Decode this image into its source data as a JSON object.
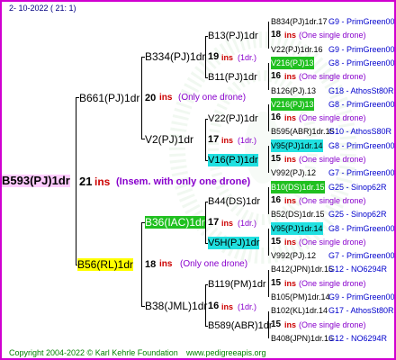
{
  "header": {
    "date": "2- 10-2022 ( 21: 1)"
  },
  "root": {
    "name": "B593(PJ)1dr",
    "num": "21",
    "ins": "ins",
    "note": "(Insem. with only one drone)"
  },
  "gen1": [
    {
      "name": "B661(PJ)1dr",
      "num": "20",
      "ins": "ins",
      "note": "(Only one drone)"
    },
    {
      "name": "B56(RL)1dr",
      "num": "18",
      "ins": "ins",
      "note": "(Only one drone)"
    }
  ],
  "gen2": [
    {
      "name": "B334(PJ)1dr"
    },
    {
      "name": "V2(PJ)1dr"
    },
    {
      "name": "B36(IAC)1dr"
    },
    {
      "name": "B38(JML)1dr"
    }
  ],
  "gen3": [
    {
      "name": "B13(PJ)1dr",
      "num": "19",
      "ins": "ins",
      "note": "(1dr.)"
    },
    {
      "name": "B11(PJ)1dr"
    },
    {
      "name": "V22(PJ)1dr",
      "num": "17",
      "ins": "ins",
      "note": "(1dr.)"
    },
    {
      "name": "V16(PJ)1dr"
    },
    {
      "name": "B44(DS)1dr",
      "num": "17",
      "ins": "ins",
      "note": "(1dr.)"
    },
    {
      "name": "V5H(PJ)1dr"
    },
    {
      "name": "B119(PM)1dr",
      "num": "16",
      "ins": "ins",
      "note": "(1dr.)"
    },
    {
      "name": "B589(ABR)1dr"
    }
  ],
  "gen4": [
    {
      "left": "B834(PJ)1dr.17",
      "right": "G9 - PrimGreen00"
    },
    {
      "num": "18",
      "ins": "ins",
      "note": "(One single drone)"
    },
    {
      "left": "V22(PJ)1dr.16",
      "right": "G9 - PrimGreen00"
    },
    {
      "left": "V216(PJ)13",
      "right": "G8 - PrimGreen00"
    },
    {
      "num": "16",
      "ins": "ins",
      "note": "(One single drone)"
    },
    {
      "left": "B126(PJ).13",
      "right": "G18 - AthosSt80R"
    },
    {
      "left": "V216(PJ)13",
      "right": "G8 - PrimGreen00"
    },
    {
      "num": "16",
      "ins": "ins",
      "note": "(One single drone)"
    },
    {
      "left": "B595(ABR)1dr.15",
      "right": "G10 - AthosS80R"
    },
    {
      "left": "V95(PJ)1dr.14",
      "right": "G8 - PrimGreen00"
    },
    {
      "num": "15",
      "ins": "ins",
      "note": "(One single drone)"
    },
    {
      "left": "V992(PJ).12",
      "right": "G7 - PrimGreen00"
    },
    {
      "left": "B10(DS)1dr.15",
      "right": "G25 - Sinop62R"
    },
    {
      "num": "16",
      "ins": "ins",
      "note": "(One single drone)"
    },
    {
      "left": "B52(DS)1dr.15",
      "right": "G25 - Sinop62R"
    },
    {
      "left": "V95(PJ)1dr.14",
      "right": "G8 - PrimGreen00"
    },
    {
      "num": "15",
      "ins": "ins",
      "note": "(One single drone)"
    },
    {
      "left": "V992(PJ).12",
      "right": "G7 - PrimGreen00"
    },
    {
      "left": "B412(JPN)1dr.15",
      "right": "G12 - NO6294R"
    },
    {
      "num": "15",
      "ins": "ins",
      "note": "(One single drone)"
    },
    {
      "left": "B105(PM)1dr.14",
      "right": "G9 - PrimGreen00"
    },
    {
      "left": "B102(KL)1dr.14",
      "right": "G17 - AthosSt80R"
    },
    {
      "num": "15",
      "ins": "ins",
      "note": "(One single drone)"
    },
    {
      "left": "B408(JPN)1dr.16",
      "right": "G12 - NO6294R"
    }
  ],
  "footer": {
    "copyright": "Copyright 2004-2022 © Karl Kehrle Foundation",
    "url": "www.pedigreeapis.org"
  }
}
